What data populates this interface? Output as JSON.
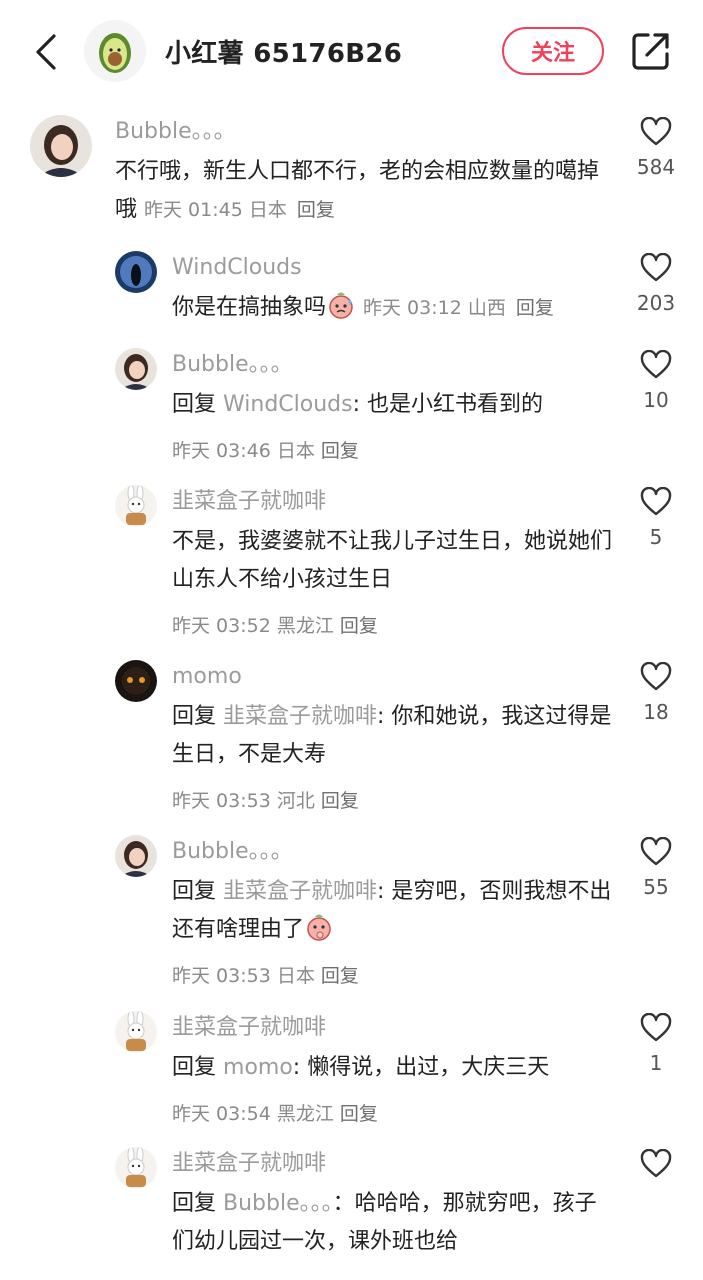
{
  "header": {
    "title": "小红薯 65176B26",
    "follow_label": "关注"
  },
  "icons": {
    "back": "chevron-left-icon",
    "share": "share-icon",
    "like": "heart-outline-icon"
  },
  "colors": {
    "accent": "#f0405a",
    "muted": "#9b9b9b"
  },
  "comments": [
    {
      "user": "Bubble。。。",
      "text": "不行哦，新生人口都不行，老的会相应数量的噶掉哦",
      "time": "昨天 01:45",
      "location": "日本",
      "reply_label": "回复",
      "likes": "584"
    },
    {
      "user": "WindClouds",
      "text": "你是在搞抽象吗",
      "time": "昨天 03:12",
      "location": "山西",
      "reply_label": "回复",
      "likes": "203"
    },
    {
      "user": "Bubble。。。",
      "reply_prefix": "回复",
      "reply_to": "WindClouds",
      "text": ": 也是小红书看到的",
      "time": "昨天 03:46",
      "location": "日本",
      "reply_label": "回复",
      "likes": "10"
    },
    {
      "user": "韭菜盒子就咖啡",
      "text": "不是，我婆婆就不让我儿子过生日，她说她们山东人不给小孩过生日",
      "time": "昨天 03:52",
      "location": "黑龙江",
      "reply_label": "回复",
      "likes": "5"
    },
    {
      "user": "momo",
      "reply_prefix": "回复",
      "reply_to": "韭菜盒子就咖啡",
      "text": ": 你和她说，我这过得是生日，不是大寿",
      "time": "昨天 03:53",
      "location": "河北",
      "reply_label": "回复",
      "likes": "18"
    },
    {
      "user": "Bubble。。。",
      "reply_prefix": "回复",
      "reply_to": "韭菜盒子就咖啡",
      "text": ": 是穷吧，否则我想不出还有啥理由了",
      "time": "昨天 03:53",
      "location": "日本",
      "reply_label": "回复",
      "likes": "55"
    },
    {
      "user": "韭菜盒子就咖啡",
      "reply_prefix": "回复",
      "reply_to": "momo",
      "text": ": 懒得说，出过，大庆三天",
      "time": "昨天 03:54",
      "location": "黑龙江",
      "reply_label": "回复",
      "likes": "1"
    },
    {
      "user": "韭菜盒子就咖啡",
      "reply_prefix": "回复",
      "reply_to": "Bubble。。。",
      "text": "：哈哈哈，那就穷吧，孩子们幼儿园过一次，课外班也给",
      "likes": ""
    }
  ]
}
